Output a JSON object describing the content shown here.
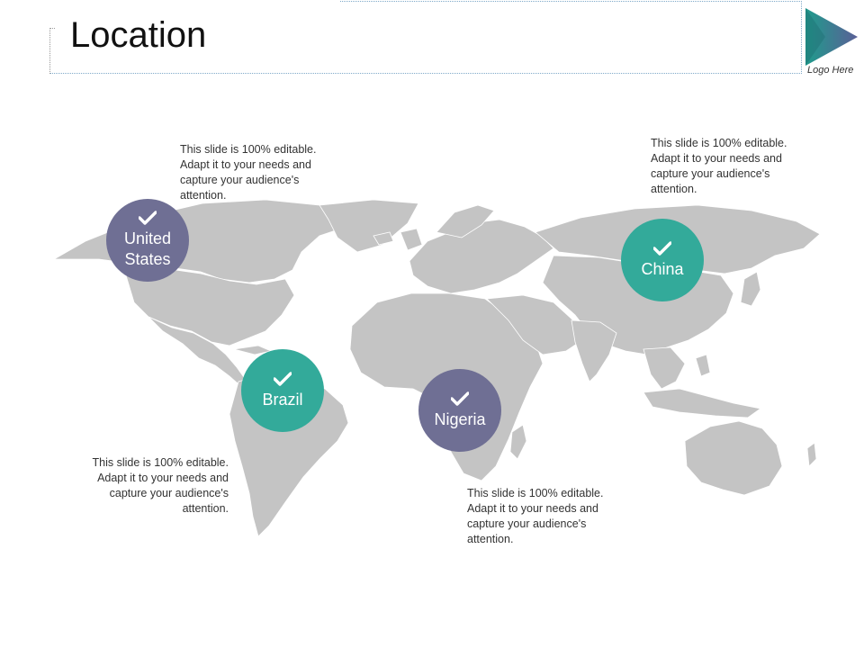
{
  "slide": {
    "title": "Location",
    "logo_label": "Logo Here"
  },
  "colors": {
    "purple": "#6f6f94",
    "teal": "#33aa9a",
    "map": "#c4c4c4",
    "logo_gradient": [
      "#2a9d8f",
      "#5b5f97"
    ]
  },
  "locations": [
    {
      "name": "United States",
      "caption": "This slide is 100% editable. Adapt it to your needs and capture your audience's attention."
    },
    {
      "name": "China",
      "caption": "This slide is 100% editable. Adapt it to your needs and capture your audience's attention."
    },
    {
      "name": "Brazil",
      "caption": "This slide is 100% editable. Adapt it to your needs and capture your audience's attention."
    },
    {
      "name": "Nigeria",
      "caption": "This slide is 100% editable. Adapt it to your needs and capture your audience's attention."
    }
  ],
  "icons": {
    "marker": "check-icon",
    "logo": "triangle-logo-icon"
  }
}
